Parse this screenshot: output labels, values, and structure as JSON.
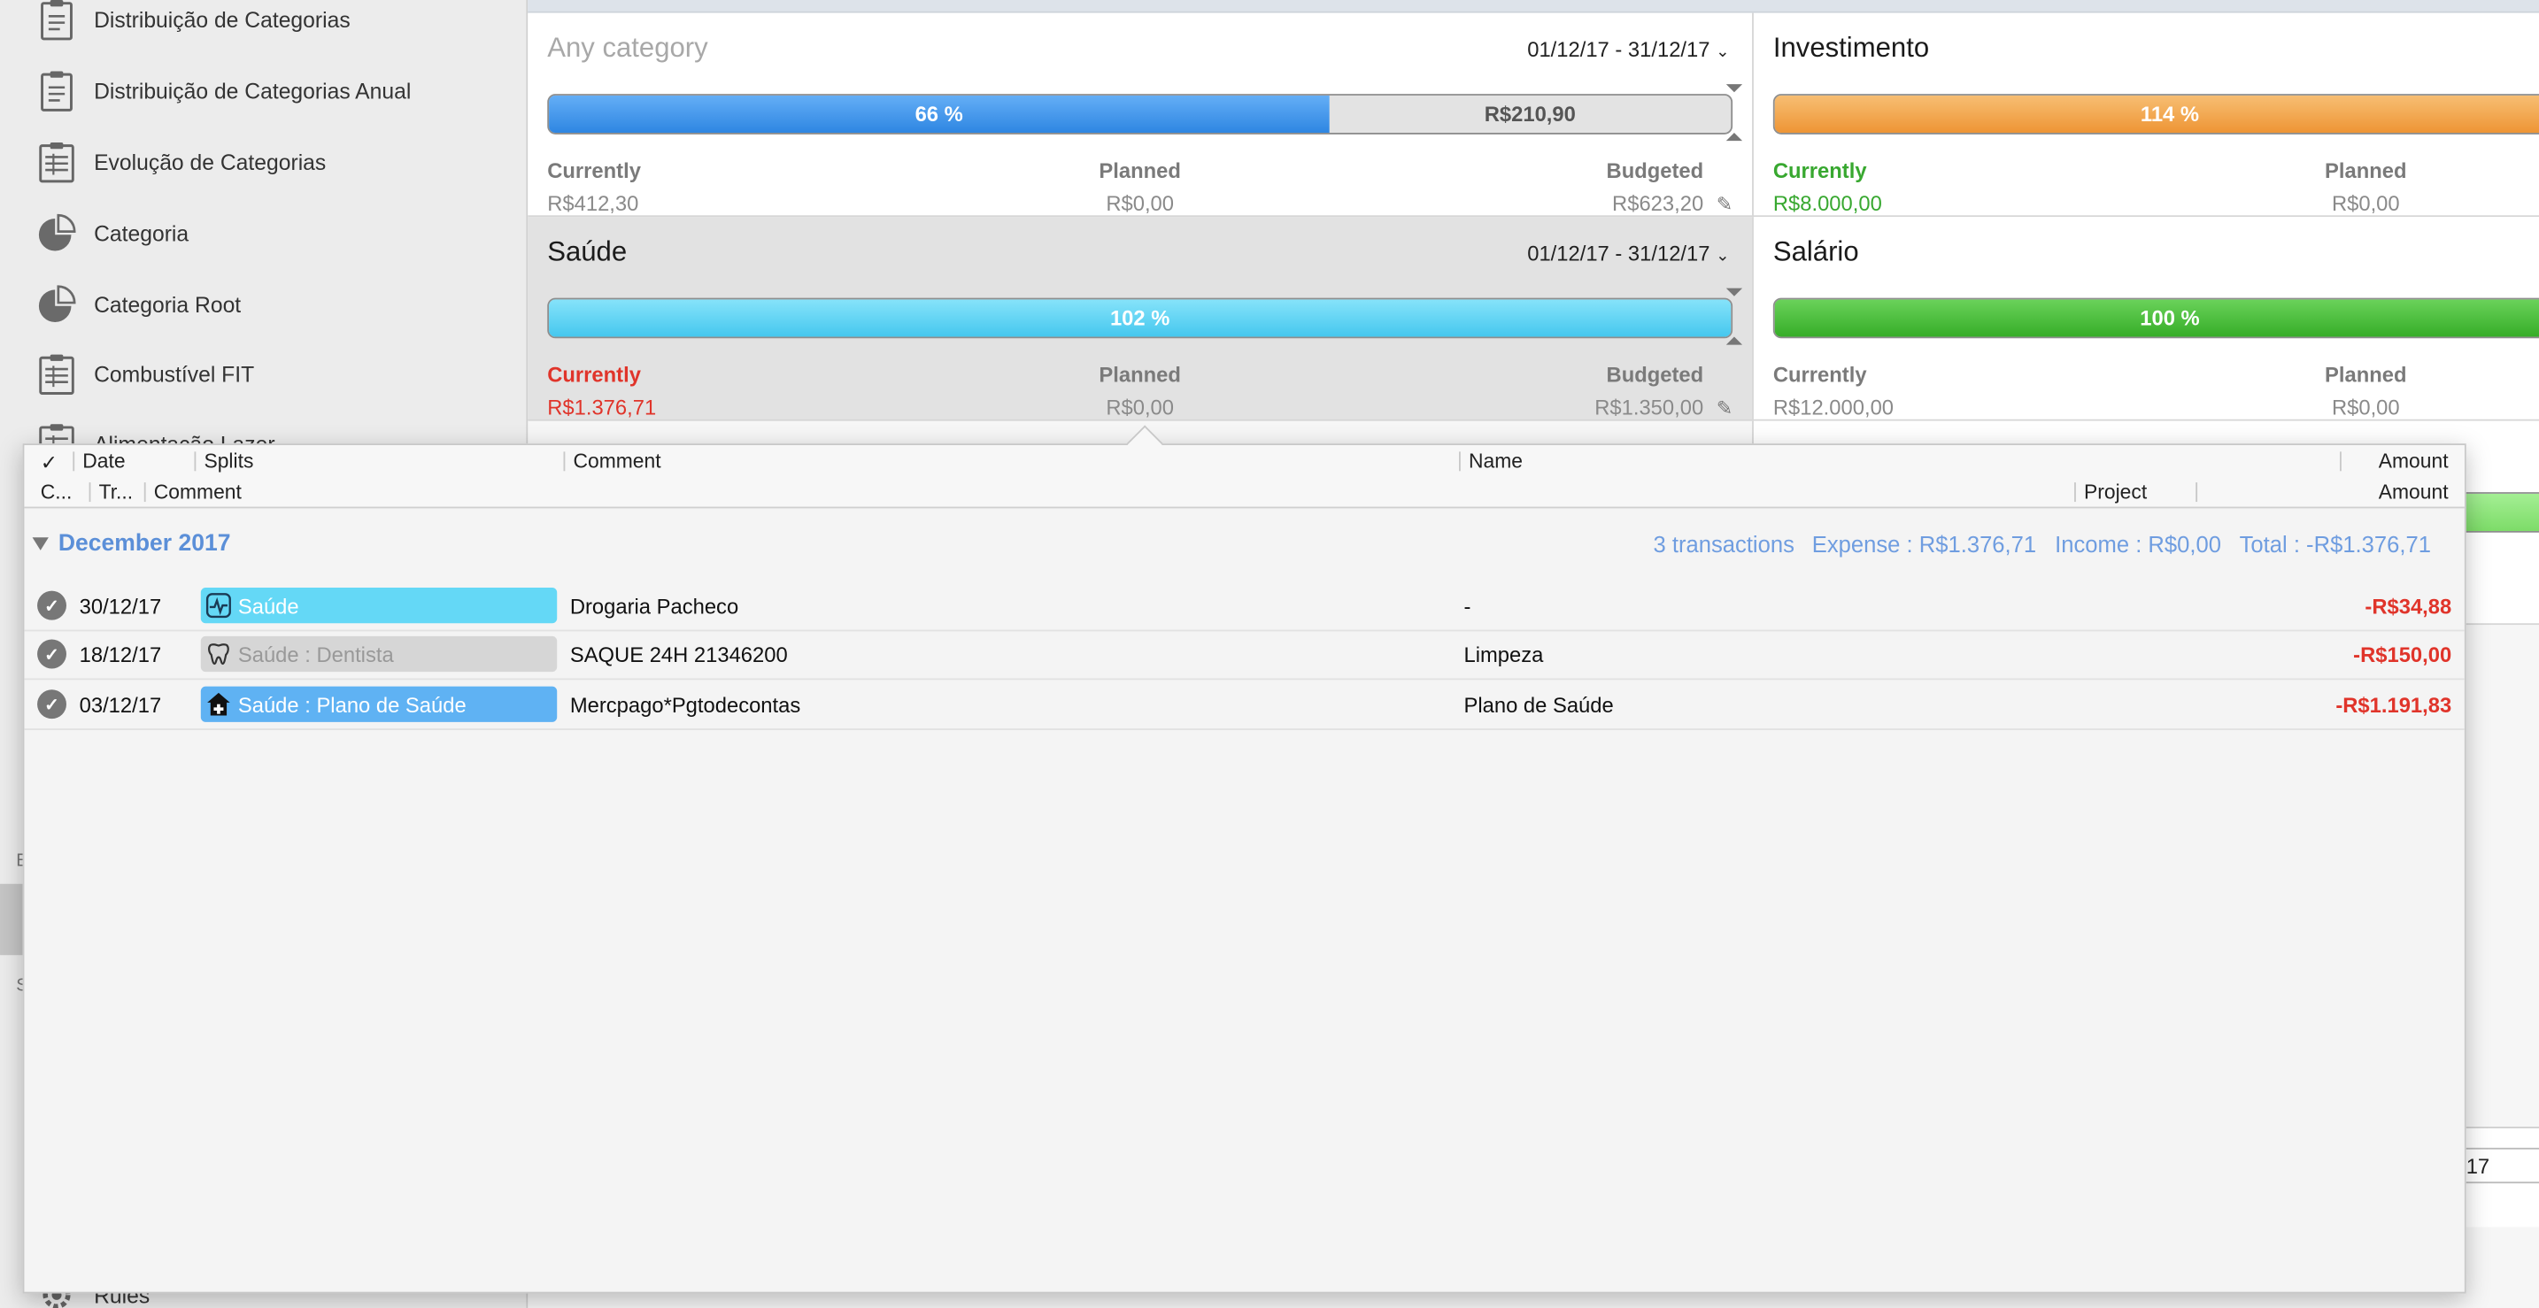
{
  "sidebar": {
    "items": [
      {
        "label": "Distribuição de Categorias",
        "icon": "report-icon"
      },
      {
        "label": "Distribuição de Categorias Anual",
        "icon": "report-icon"
      },
      {
        "label": "Evolução de Categorias",
        "icon": "table-report-icon"
      },
      {
        "label": "Categoria",
        "icon": "pie-chart-icon"
      },
      {
        "label": "Categoria Root",
        "icon": "pie-chart-icon"
      },
      {
        "label": "Combustível FIT",
        "icon": "table-report-icon"
      },
      {
        "label": "Alimentação Lazer",
        "icon": "table-report-icon"
      },
      {
        "label": "Rules",
        "icon": "gear-icon"
      }
    ],
    "frag_e": "E",
    "frag_s": "S"
  },
  "budgets": [
    {
      "title": "Any category",
      "date": "01/12/17 - 31/12/17",
      "percent_label": "66 %",
      "fill_fraction": 0.66,
      "remaining": "R$210,90",
      "color": "#2e86e2",
      "currently_label": "Currently",
      "currently_value": "R$412,30",
      "planned_label": "Planned",
      "planned_value": "R$0,00",
      "budgeted_label": "Budgeted",
      "budgeted_value": "R$623,20"
    },
    {
      "title": "Saúde",
      "date": "01/12/17 - 31/12/17",
      "percent_label": "102 %",
      "fill_fraction": 1.0,
      "color": "#45c7ee",
      "currently_label": "Currently",
      "currently_value": "R$1.376,71",
      "planned_label": "Planned",
      "planned_value": "R$0,00",
      "budgeted_label": "Budgeted",
      "budgeted_value": "R$1.350,00"
    },
    {
      "title": "Investimento",
      "percent_label": "114 %",
      "fill_fraction": 1.0,
      "color": "#ee9535",
      "currently_label": "Currently",
      "currently_value": "R$8.000,00",
      "planned_label": "Planned",
      "planned_value": "R$0,00"
    },
    {
      "title": "Salário",
      "percent_label": "100 %",
      "fill_fraction": 1.0,
      "color": "#36ad28",
      "currently_label": "Currently",
      "currently_value": "R$12.000,00",
      "planned_label": "Planned",
      "planned_value": "R$0,00"
    }
  ],
  "background_fragment": {
    "date_tail": "17"
  },
  "popover": {
    "header_row1": {
      "check": "✓",
      "date": "Date",
      "splits": "Splits",
      "comment": "Comment",
      "name": "Name",
      "amount": "Amount"
    },
    "header_row2": {
      "c": "C...",
      "tr": "Tr...",
      "comment": "Comment",
      "project": "Project",
      "amount": "Amount"
    },
    "group": {
      "name": "December 2017",
      "count": "3 transactions",
      "expense": "Expense : R$1.376,71",
      "income": "Income : R$0,00",
      "total": "Total : -R$1.376,71"
    },
    "transactions": [
      {
        "date": "30/12/17",
        "category": "Saúde",
        "category_icon": "heartbeat-icon",
        "comment": "Drogaria Pacheco",
        "name": "-",
        "amount": "-R$34,88"
      },
      {
        "date": "18/12/17",
        "category": "Saúde : Dentista",
        "category_icon": "tooth-icon",
        "comment": "SAQUE 24H 21346200",
        "name": "Limpeza",
        "amount": "-R$150,00"
      },
      {
        "date": "03/12/17",
        "category": "Saúde : Plano de Saúde",
        "category_icon": "medical-house-icon",
        "comment": "Mercpago*Pgtodecontas",
        "name": "Plano de Saúde",
        "amount": "-R$1.191,83"
      }
    ]
  }
}
